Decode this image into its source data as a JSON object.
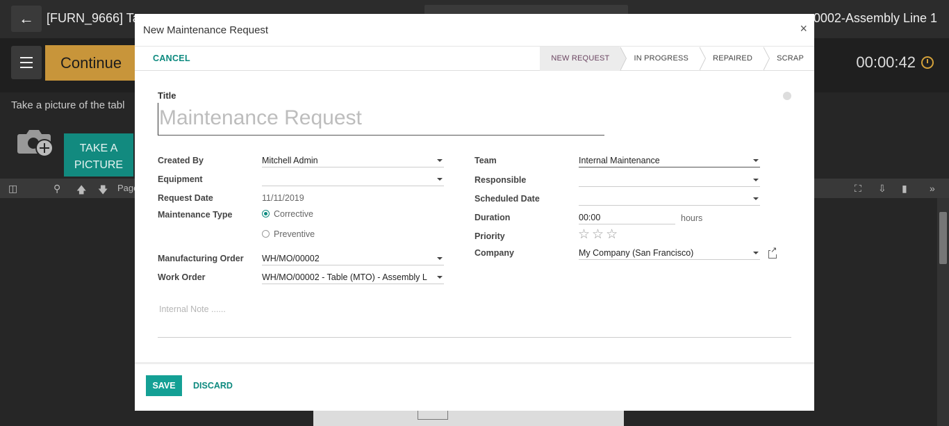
{
  "background": {
    "title": "[FURN_9666] Ta",
    "title_right": "0002-Assembly Line 1",
    "continue_label": "Continue",
    "timer": "00:00:42",
    "instruction": "Take a picture of the tabl",
    "take_picture_label": "TAKE A PICTURE",
    "pdf_page_label": "Page"
  },
  "modal": {
    "title": "New Maintenance Request",
    "close_symbol": "×",
    "cancel_label": "CANCEL",
    "stages": [
      "NEW REQUEST",
      "IN PROGRESS",
      "REPAIRED",
      "SCRAP"
    ],
    "title_label": "Title",
    "title_placeholder": "Maintenance Request",
    "left": {
      "created_by_label": "Created By",
      "created_by_value": "Mitchell Admin",
      "equipment_label": "Equipment",
      "equipment_value": "",
      "request_date_label": "Request Date",
      "request_date_value": "11/11/2019",
      "maintenance_type_label": "Maintenance Type",
      "maintenance_type_options": [
        "Corrective",
        "Preventive"
      ],
      "manufacturing_order_label": "Manufacturing Order",
      "manufacturing_order_value": "WH/MO/00002",
      "work_order_label": "Work Order",
      "work_order_value": "WH/MO/00002 - Table (MTO) - Assembly L"
    },
    "right": {
      "team_label": "Team",
      "team_value": "Internal Maintenance",
      "responsible_label": "Responsible",
      "responsible_value": "",
      "scheduled_date_label": "Scheduled Date",
      "scheduled_date_value": "",
      "duration_label": "Duration",
      "duration_value": "00:00",
      "duration_unit": "hours",
      "priority_label": "Priority",
      "priority_stars": "☆☆☆",
      "company_label": "Company",
      "company_value": "My Company (San Francisco)"
    },
    "note_placeholder": "Internal Note ......",
    "save_label": "SAVE",
    "discard_label": "DISCARD"
  },
  "colors": {
    "accent": "#0d8a7f",
    "save_button": "#14a095",
    "continue_button": "#c8953a",
    "active_stage_text": "#6a4460"
  }
}
